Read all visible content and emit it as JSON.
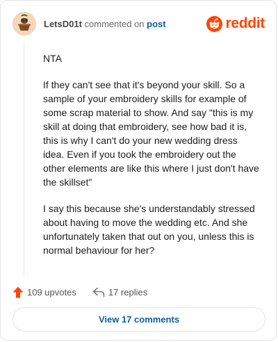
{
  "header": {
    "username": "LetsD01t",
    "action_text": "commented on",
    "post_link": "post",
    "brand": "reddit"
  },
  "comment": {
    "paragraphs": [
      "NTA",
      "If they can't see that it's beyond your skill. So a sample of your embroidery skills for example of some scrap material to show. And say \"this is my skill at doing that embroidery, see how bad it is, this is why I can't do your new wedding dress idea. Even if you took the embroidery out the other elements are like this where I just don't have the skillset\"",
      "I say this because she's understandably stressed about having to move the wedding etc. And she unfortunately taken that out on you, unless this is normal behaviour for her?"
    ]
  },
  "stats": {
    "upvotes": "109 upvotes",
    "replies": "17 replies"
  },
  "footer": {
    "view_comments_label": "View 17 comments"
  },
  "icons": {
    "avatar": "user-avatar-icon",
    "brand": "reddit-logo-icon",
    "upvote": "upvote-arrow-icon",
    "reply": "reply-arrow-icon"
  },
  "colors": {
    "brand": "#ff4500",
    "link": "#0b5ea8",
    "text": "#1c1c1c",
    "muted": "#6a6a6a",
    "upvote": "#ff4500",
    "border": "#e3e3e3"
  }
}
